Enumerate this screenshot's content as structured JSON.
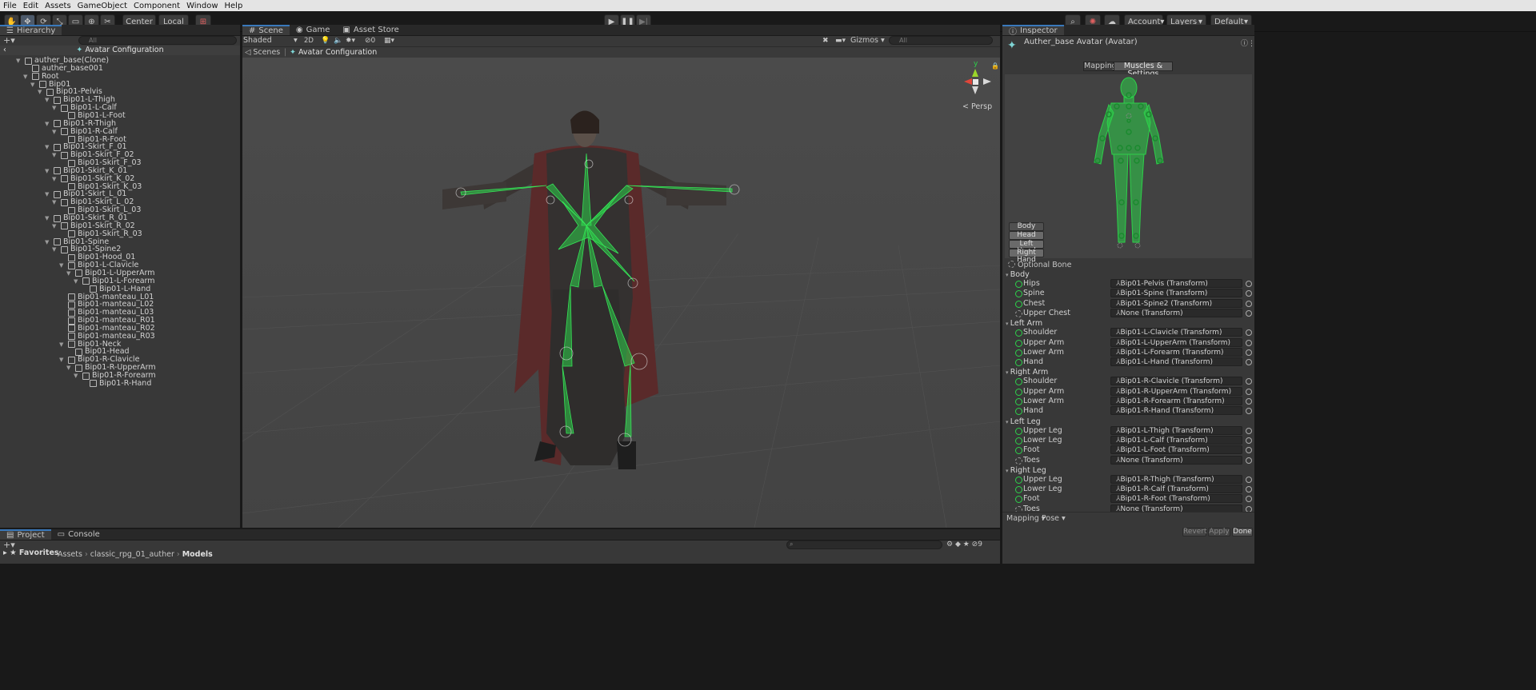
{
  "menu": [
    "File",
    "Edit",
    "Assets",
    "GameObject",
    "Component",
    "Window",
    "Help"
  ],
  "toolbar": {
    "pivot_label": "Center",
    "space_label": "Local",
    "account_label": "Account",
    "layers_label": "Layers",
    "layout_label": "Default"
  },
  "hierarchy": {
    "tab_label": "Hierarchy",
    "search_placeholder": "All",
    "context_title": "Avatar Configuration",
    "items": [
      {
        "label": "auther_base(Clone)",
        "depth": 0,
        "expanded": true
      },
      {
        "label": "auther_base001",
        "depth": 1,
        "expanded": null
      },
      {
        "label": "Root",
        "depth": 1,
        "expanded": true
      },
      {
        "label": "Bip01",
        "depth": 2,
        "expanded": true
      },
      {
        "label": "Bip01-Pelvis",
        "depth": 3,
        "expanded": true
      },
      {
        "label": "Bip01-L-Thigh",
        "depth": 4,
        "expanded": true
      },
      {
        "label": "Bip01-L-Calf",
        "depth": 5,
        "expanded": true
      },
      {
        "label": "Bip01-L-Foot",
        "depth": 6,
        "expanded": null
      },
      {
        "label": "Bip01-R-Thigh",
        "depth": 4,
        "expanded": true
      },
      {
        "label": "Bip01-R-Calf",
        "depth": 5,
        "expanded": true
      },
      {
        "label": "Bip01-R-Foot",
        "depth": 6,
        "expanded": null
      },
      {
        "label": "Bip01-Skirt_F_01",
        "depth": 4,
        "expanded": true
      },
      {
        "label": "Bip01-Skirt_F_02",
        "depth": 5,
        "expanded": true
      },
      {
        "label": "Bip01-Skirt_F_03",
        "depth": 6,
        "expanded": null
      },
      {
        "label": "Bip01-Skirt_K_01",
        "depth": 4,
        "expanded": true
      },
      {
        "label": "Bip01-Skirt_K_02",
        "depth": 5,
        "expanded": true
      },
      {
        "label": "Bip01-Skirt_K_03",
        "depth": 6,
        "expanded": null
      },
      {
        "label": "Bip01-Skirt_L_01",
        "depth": 4,
        "expanded": true
      },
      {
        "label": "Bip01-Skirt_L_02",
        "depth": 5,
        "expanded": true
      },
      {
        "label": "Bip01-Skirt_L_03",
        "depth": 6,
        "expanded": null
      },
      {
        "label": "Bip01-Skirt_R_01",
        "depth": 4,
        "expanded": true
      },
      {
        "label": "Bip01-Skirt_R_02",
        "depth": 5,
        "expanded": true
      },
      {
        "label": "Bip01-Skirt_R_03",
        "depth": 6,
        "expanded": null
      },
      {
        "label": "Bip01-Spine",
        "depth": 4,
        "expanded": true
      },
      {
        "label": "Bip01-Spine2",
        "depth": 5,
        "expanded": true
      },
      {
        "label": "Bip01-Hood_01",
        "depth": 6,
        "expanded": null
      },
      {
        "label": "Bip01-L-Clavicle",
        "depth": 6,
        "expanded": true
      },
      {
        "label": "Bip01-L-UpperArm",
        "depth": 7,
        "expanded": true
      },
      {
        "label": "Bip01-L-Forearm",
        "depth": 8,
        "expanded": true
      },
      {
        "label": "Bip01-L-Hand",
        "depth": 9,
        "expanded": null
      },
      {
        "label": "Bip01-manteau_L01",
        "depth": 6,
        "expanded": null
      },
      {
        "label": "Bip01-manteau_L02",
        "depth": 6,
        "expanded": null
      },
      {
        "label": "Bip01-manteau_L03",
        "depth": 6,
        "expanded": null
      },
      {
        "label": "Bip01-manteau_R01",
        "depth": 6,
        "expanded": null
      },
      {
        "label": "Bip01-manteau_R02",
        "depth": 6,
        "expanded": null
      },
      {
        "label": "Bip01-manteau_R03",
        "depth": 6,
        "expanded": null
      },
      {
        "label": "Bip01-Neck",
        "depth": 6,
        "expanded": true
      },
      {
        "label": "Bip01-Head",
        "depth": 7,
        "expanded": null
      },
      {
        "label": "Bip01-R-Clavicle",
        "depth": 6,
        "expanded": true
      },
      {
        "label": "Bip01-R-UpperArm",
        "depth": 7,
        "expanded": true
      },
      {
        "label": "Bip01-R-Forearm",
        "depth": 8,
        "expanded": true
      },
      {
        "label": "Bip01-R-Hand",
        "depth": 9,
        "expanded": null
      }
    ]
  },
  "scene": {
    "tabs": [
      "Scene",
      "Game",
      "Asset Store"
    ],
    "shading_mode": "Shaded",
    "mode_2d": "2D",
    "hidden_count": "0",
    "gizmos_label": "Gizmos",
    "search_placeholder": "All",
    "breadcrumb_root": "Scenes",
    "breadcrumb_current": "Avatar Configuration",
    "persp_label": "Persp",
    "axis_y": "y"
  },
  "inspector": {
    "tab_label": "Inspector",
    "title": "Auther_base Avatar (Avatar)",
    "tabs": [
      "Mapping",
      "Muscles & Settings"
    ],
    "body_buttons": [
      "Body",
      "Head",
      "Left Hand",
      "Right Hand"
    ],
    "optional_bone": "Optional Bone",
    "groups": [
      {
        "name": "Body",
        "rows": [
          {
            "label": "Hips",
            "value": "Bip01-Pelvis (Transform)",
            "assigned": true
          },
          {
            "label": "Spine",
            "value": "Bip01-Spine (Transform)",
            "assigned": true
          },
          {
            "label": "Chest",
            "value": "Bip01-Spine2 (Transform)",
            "assigned": true
          },
          {
            "label": "Upper Chest",
            "value": "None (Transform)",
            "assigned": false
          }
        ]
      },
      {
        "name": "Left Arm",
        "rows": [
          {
            "label": "Shoulder",
            "value": "Bip01-L-Clavicle (Transform)",
            "assigned": true
          },
          {
            "label": "Upper Arm",
            "value": "Bip01-L-UpperArm (Transform)",
            "assigned": true
          },
          {
            "label": "Lower Arm",
            "value": "Bip01-L-Forearm (Transform)",
            "assigned": true
          },
          {
            "label": "Hand",
            "value": "Bip01-L-Hand (Transform)",
            "assigned": true
          }
        ]
      },
      {
        "name": "Right Arm",
        "rows": [
          {
            "label": "Shoulder",
            "value": "Bip01-R-Clavicle (Transform)",
            "assigned": true
          },
          {
            "label": "Upper Arm",
            "value": "Bip01-R-UpperArm (Transform)",
            "assigned": true
          },
          {
            "label": "Lower Arm",
            "value": "Bip01-R-Forearm (Transform)",
            "assigned": true
          },
          {
            "label": "Hand",
            "value": "Bip01-R-Hand (Transform)",
            "assigned": true
          }
        ]
      },
      {
        "name": "Left Leg",
        "rows": [
          {
            "label": "Upper Leg",
            "value": "Bip01-L-Thigh (Transform)",
            "assigned": true
          },
          {
            "label": "Lower Leg",
            "value": "Bip01-L-Calf (Transform)",
            "assigned": true
          },
          {
            "label": "Foot",
            "value": "Bip01-L-Foot (Transform)",
            "assigned": true
          },
          {
            "label": "Toes",
            "value": "None (Transform)",
            "assigned": false
          }
        ]
      },
      {
        "name": "Right Leg",
        "rows": [
          {
            "label": "Upper Leg",
            "value": "Bip01-R-Thigh (Transform)",
            "assigned": true
          },
          {
            "label": "Lower Leg",
            "value": "Bip01-R-Calf (Transform)",
            "assigned": true
          },
          {
            "label": "Foot",
            "value": "Bip01-R-Foot (Transform)",
            "assigned": true
          },
          {
            "label": "Toes",
            "value": "None (Transform)",
            "assigned": false
          }
        ]
      }
    ],
    "mapping_dropdown": "Mapping",
    "pose_dropdown": "Pose",
    "revert_label": "Revert",
    "apply_label": "Apply",
    "done_label": "Done"
  },
  "project": {
    "tabs": [
      "Project",
      "Console"
    ],
    "favorites_label": "Favorites",
    "breadcrumb": [
      "Assets",
      "classic_rpg_01_auther",
      "Models"
    ],
    "hidden_packages": "9"
  },
  "colors": {
    "accent": "#3a79bb",
    "bone_green": "#2dd14a",
    "panel": "#383838",
    "scene_bg": "#474747"
  }
}
